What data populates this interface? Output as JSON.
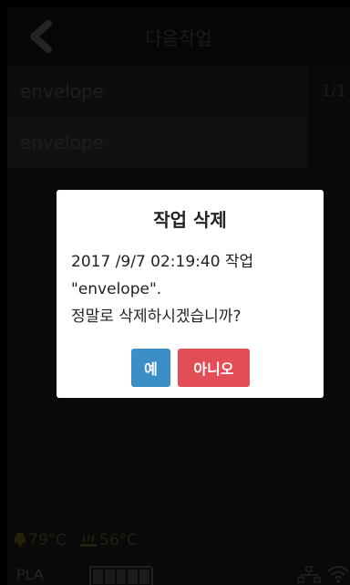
{
  "header": {
    "title": "다음작업"
  },
  "jobs": [
    {
      "name": "envelope"
    },
    {
      "name": "envelope"
    }
  ],
  "page_indicator": "1/1",
  "dialog": {
    "title": "작업 삭제",
    "message_line1": "2017 /9/7 02:19:40 작업",
    "message_line2": "\"envelope\".",
    "message_line3": "정말로 삭제하시겠습니까?",
    "yes_label": "예",
    "no_label": "아니오"
  },
  "status": {
    "nozzle_temp": "79°C",
    "bed_temp": "56°C",
    "filament": "PLA"
  },
  "colors": {
    "yes_button": "#3c8fc6",
    "no_button": "#e24d56"
  }
}
